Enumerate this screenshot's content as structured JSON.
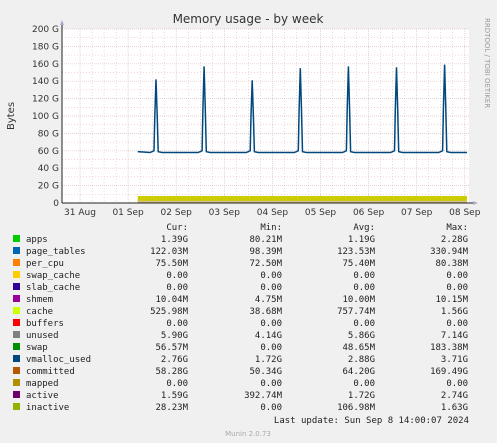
{
  "chart_data": {
    "type": "line",
    "title": "Memory usage - by week",
    "ylabel": "Bytes",
    "ylim": [
      0,
      200
    ],
    "yunit": "G",
    "y_ticks": [
      "0",
      "20 G",
      "40 G",
      "60 G",
      "80 G",
      "100 G",
      "120 G",
      "140 G",
      "160 G",
      "180 G",
      "200 G"
    ],
    "x_ticks": [
      "31 Aug",
      "01 Sep",
      "02 Sep",
      "03 Sep",
      "04 Sep",
      "05 Sep",
      "06 Sep",
      "07 Sep",
      "08 Sep"
    ],
    "data_start_day": 1.2,
    "committed_baseline": 58,
    "committed_peaks": [
      {
        "day": 1.58,
        "value": 142
      },
      {
        "day": 2.58,
        "value": 157
      },
      {
        "day": 3.58,
        "value": 141
      },
      {
        "day": 4.58,
        "value": 155
      },
      {
        "day": 5.58,
        "value": 157
      },
      {
        "day": 6.58,
        "value": 156
      },
      {
        "day": 7.58,
        "value": 159
      }
    ],
    "stack_band_top": 8,
    "legend_headers": [
      "Cur:",
      "Min:",
      "Avg:",
      "Max:"
    ],
    "series": [
      {
        "name": "apps",
        "color": "#00cc00",
        "cur": "1.39G",
        "min": "80.21M",
        "avg": "1.19G",
        "max": "2.28G"
      },
      {
        "name": "page_tables",
        "color": "#0066b3",
        "cur": "122.03M",
        "min": "98.39M",
        "avg": "123.53M",
        "max": "330.94M"
      },
      {
        "name": "per_cpu",
        "color": "#ff8000",
        "cur": "75.50M",
        "min": "72.50M",
        "avg": "75.40M",
        "max": "80.38M"
      },
      {
        "name": "swap_cache",
        "color": "#ffcc00",
        "cur": "0.00",
        "min": "0.00",
        "avg": "0.00",
        "max": "0.00"
      },
      {
        "name": "slab_cache",
        "color": "#330099",
        "cur": "0.00",
        "min": "0.00",
        "avg": "0.00",
        "max": "0.00"
      },
      {
        "name": "shmem",
        "color": "#990099",
        "cur": "10.04M",
        "min": "4.75M",
        "avg": "10.00M",
        "max": "10.15M"
      },
      {
        "name": "cache",
        "color": "#ccff00",
        "cur": "525.98M",
        "min": "38.68M",
        "avg": "757.74M",
        "max": "1.56G"
      },
      {
        "name": "buffers",
        "color": "#ff0000",
        "cur": "0.00",
        "min": "0.00",
        "avg": "0.00",
        "max": "0.00"
      },
      {
        "name": "unused",
        "color": "#808080",
        "cur": "5.90G",
        "min": "4.14G",
        "avg": "5.86G",
        "max": "7.14G"
      },
      {
        "name": "swap",
        "color": "#008f00",
        "cur": "56.57M",
        "min": "0.00",
        "avg": "48.65M",
        "max": "183.38M"
      },
      {
        "name": "vmalloc_used",
        "color": "#00487d",
        "cur": "2.76G",
        "min": "1.72G",
        "avg": "2.88G",
        "max": "3.71G"
      },
      {
        "name": "committed",
        "color": "#b35a00",
        "cur": "58.28G",
        "min": "50.34G",
        "avg": "64.20G",
        "max": "169.49G"
      },
      {
        "name": "mapped",
        "color": "#b38f00",
        "cur": "0.00",
        "min": "0.00",
        "avg": "0.00",
        "max": "0.00"
      },
      {
        "name": "active",
        "color": "#6b006b",
        "cur": "1.59G",
        "min": "392.74M",
        "avg": "1.72G",
        "max": "2.74G"
      },
      {
        "name": "inactive",
        "color": "#8fb300",
        "cur": "28.23M",
        "min": "0.00",
        "avg": "106.98M",
        "max": "1.63G"
      }
    ],
    "last_update": "Last update:  Sun Sep  8 14:00:07 2024",
    "side_label": "RRDTOOL / TOBI OETIKER",
    "footer": "Munin 2.0.73"
  },
  "colors": {
    "background": "#f0f0f0",
    "plot_bg": "#ffffff",
    "grid_minor": "#eeaaaa",
    "grid_major": "#e0c0c0",
    "committed_line": "#00487d",
    "band_unused": "#cccc00",
    "band_dark": "#7a6b3a",
    "band_active": "#d4c4a0"
  }
}
